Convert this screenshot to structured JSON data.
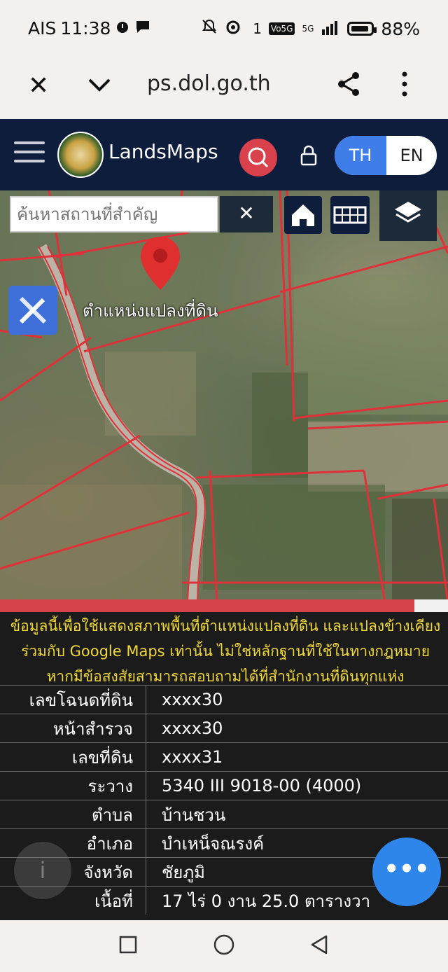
{
  "status_bar": {
    "carrier": "AIS",
    "time": "11:38",
    "network_label": "Vo5G",
    "sim_number": "1",
    "signal_label": "5G",
    "battery": "88%"
  },
  "browser": {
    "url": "ps.dol.go.th"
  },
  "app_header": {
    "brand": "LandsMaps",
    "lang_th": "TH",
    "lang_en": "EN"
  },
  "map": {
    "search_placeholder": "ค้นหาสถานที่สำคัญ",
    "clear_label": "✕",
    "parcel_label": "ตำแหน่งแปลงที่ดิน",
    "progress_fraction": 0.925
  },
  "disclaimer": "ข้อมูลนี้เพื่อใช้แสดงสภาพพื้นที่ตำแหน่งแปลงที่ดิน และแปลงข้างเคียงร่วมกับ Google Maps เท่านั้น ไม่ใช่หลักฐานที่ใช้ในทางกฎหมาย หากมีข้อสงสัยสามารถสอบถามได้ที่สำนักงานที่ดินทุกแห่ง",
  "parcel_info": [
    {
      "label": "เลขโฉนดที่ดิน",
      "value": "xxxx30"
    },
    {
      "label": "หน้าสำรวจ",
      "value": "xxxx30"
    },
    {
      "label": "เลขที่ดิน",
      "value": "xxxx31"
    },
    {
      "label": "ระวาง",
      "value": "5340 III 9018-00 (4000)"
    },
    {
      "label": "ตำบล",
      "value": "บ้านชวน"
    },
    {
      "label": "อำเภอ",
      "value": "บำเหน็จณรงค์"
    },
    {
      "label": "จังหวัด",
      "value": "ชัยภูมิ"
    },
    {
      "label": "เนื้อที่",
      "value": "17 ไร่ 0 งาน 25.0 ตารางวา"
    }
  ],
  "fab_label": "•••",
  "info_label": "i"
}
